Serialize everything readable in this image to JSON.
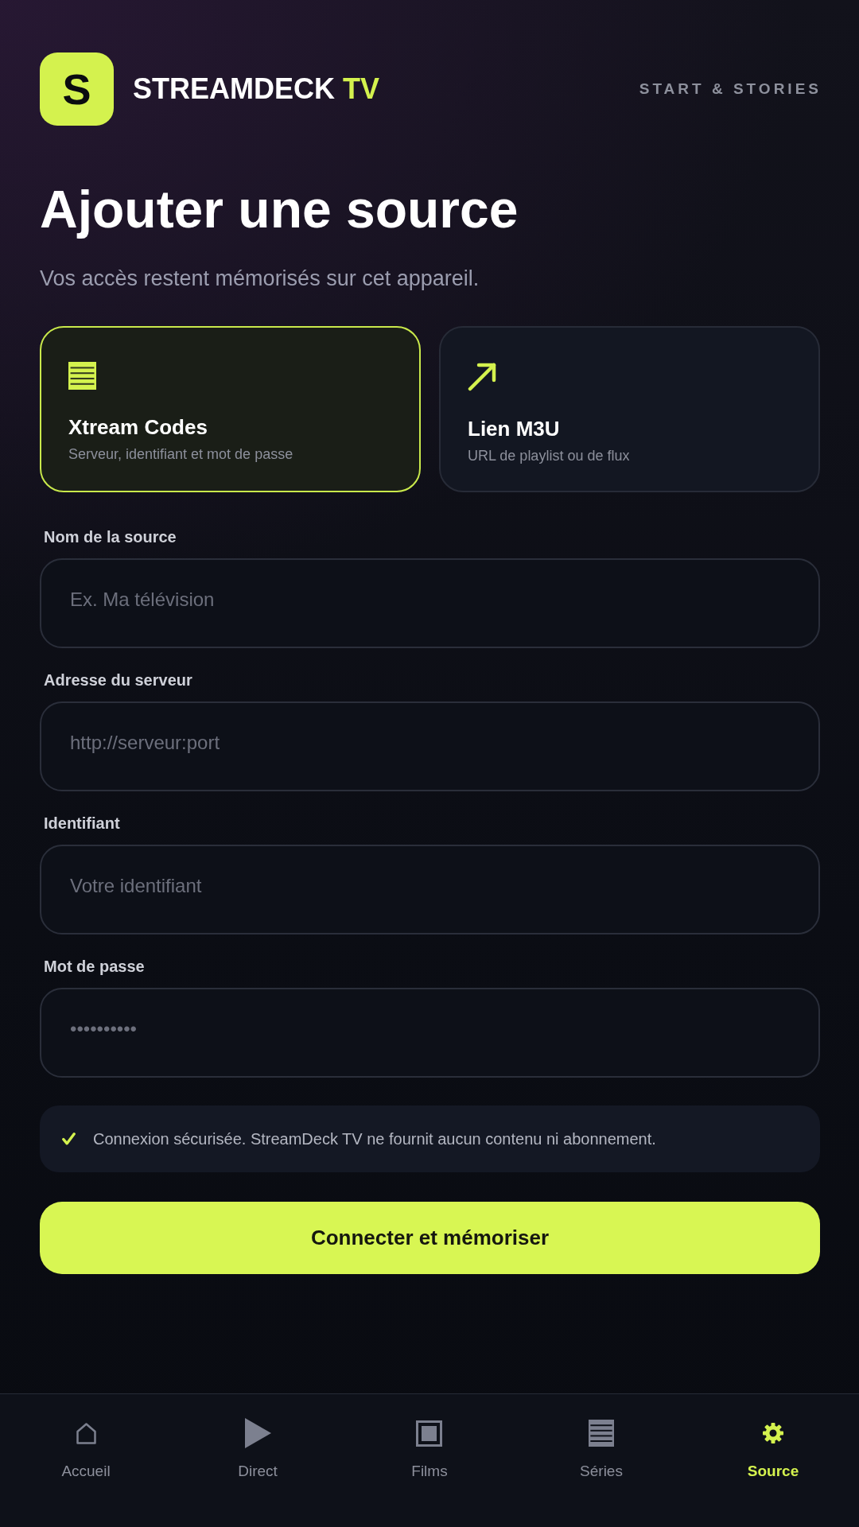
{
  "header": {
    "logo_letter": "S",
    "brand_name": "STREAMDECK",
    "brand_accent": "TV",
    "link": "START & STORIES"
  },
  "title": "Ajouter une source",
  "subtitle": "Vos accès restent mémorisés sur cet appareil.",
  "source_types": [
    {
      "kind": "xtream",
      "title": "Xtream Codes",
      "description": "Serveur, identifiant et mot de passe",
      "selected": true
    },
    {
      "kind": "m3u",
      "title": "Lien M3U",
      "description": "URL de playlist ou de flux",
      "selected": false
    }
  ],
  "fields": [
    {
      "label": "Nom de la source",
      "placeholder": "Ex. Ma télévision"
    },
    {
      "label": "Adresse du serveur",
      "placeholder": "http://serveur:port"
    },
    {
      "label": "Identifiant",
      "placeholder": "Votre identifiant"
    },
    {
      "label": "Mot de passe",
      "placeholder": "••••••••••"
    }
  ],
  "notice": "Connexion sécurisée. StreamDeck TV ne fournit aucun contenu ni abonnement.",
  "submit_button": "Connecter et mémoriser",
  "bottom_nav": [
    {
      "kind": "home",
      "label": "Accueil",
      "selected": false
    },
    {
      "kind": "live",
      "label": "Direct",
      "selected": false
    },
    {
      "kind": "films",
      "label": "Films",
      "selected": false
    },
    {
      "kind": "series",
      "label": "Séries",
      "selected": false
    },
    {
      "kind": "source",
      "label": "Source",
      "selected": true
    }
  ]
}
